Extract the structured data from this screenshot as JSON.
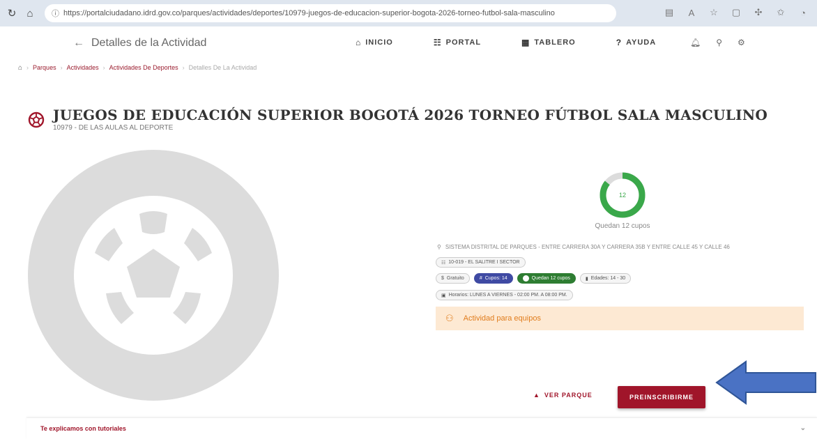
{
  "browser": {
    "url": "https://portalciudadano.idrd.gov.co/parques/actividades/deportes/10979-juegos-de-educacion-superior-bogota-2026-torneo-futbol-sala-masculino"
  },
  "header": {
    "title": "Detalles de la Actividad",
    "nav": [
      {
        "label": "INICIO",
        "icon": "home-icon"
      },
      {
        "label": "PORTAL",
        "icon": "portal-icon"
      },
      {
        "label": "TABLERO",
        "icon": "grid-icon"
      },
      {
        "label": "AYUDA",
        "icon": "help-icon"
      }
    ]
  },
  "breadcrumb": [
    "Parques",
    "Actividades",
    "Actividades De Deportes",
    "Detalles De La Actividad"
  ],
  "activity": {
    "title": "JUEGOS DE EDUCACIÓN SUPERIOR BOGOTÁ 2026 TORNEO FÚTBOL SALA MASCULINO",
    "subtitle": "10979 - DE LAS AULAS AL DEPORTE",
    "quota_remaining": "12",
    "quota_fraction": 0.857,
    "quota_caption": "Quedan 12 cupos",
    "location": "SISTEMA DISTRITAL DE PARQUES - ENTRE CARRERA 30A Y CARRERA 35B Y ENTRE CALLE 45 Y CALLE 46",
    "place_chip": "10-019 - EL SALITRE I SECTOR",
    "chips": {
      "price": "Gratuito",
      "cupos": "Cupos: 14",
      "quedan": "Quedan 12 cupos",
      "edades": "Edades: 14 - 30"
    },
    "schedule": "Horarios: LUNES A VIERNES - 02:00 PM. A 08:00 PM.",
    "team_note": "Actividad para equipos"
  },
  "actions": {
    "ver_parque": "VER PARQUE",
    "preinscribirme": "PREINSCRIBIRME"
  },
  "tutorials": {
    "label": "Te explicamos con tutoriales"
  },
  "colors": {
    "brand": "#a0152a",
    "donut_green": "#3aa84a",
    "chip_blue": "#3f4aa3",
    "chip_green": "#2e7d32",
    "team_bg": "#fde9d3",
    "annotation_arrow": "#4a72c4"
  }
}
